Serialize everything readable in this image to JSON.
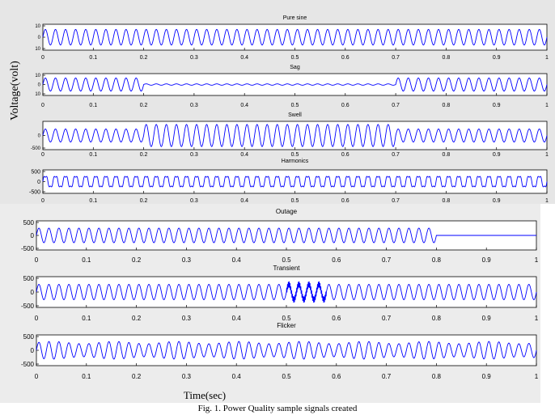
{
  "figure": {
    "ylabel": "Voltage(volt)",
    "xlabel": "Time(sec)",
    "caption": "Fig. 1. Power Quality sample signals created"
  },
  "colors": {
    "signal": "#0000ff",
    "axes": "#000000"
  },
  "chart_data": [
    {
      "type": "line",
      "title": "Pure sine",
      "xlim": [
        0,
        1
      ],
      "ylim": [
        -10,
        10
      ],
      "xticks": [
        0,
        0.1,
        0.2,
        0.3,
        0.4,
        0.5,
        0.6,
        0.7,
        0.8,
        0.9,
        1
      ],
      "ytick_labels": [
        "10",
        "0",
        "10"
      ],
      "frequency_hz": 50,
      "amplitude": 6,
      "segments": []
    },
    {
      "type": "line",
      "title": "Sag",
      "xlim": [
        0,
        1
      ],
      "ylim": [
        -10,
        10
      ],
      "xticks": [
        0,
        0.1,
        0.2,
        0.3,
        0.4,
        0.5,
        0.6,
        0.7,
        0.8,
        0.9,
        1
      ],
      "ytick_labels": [
        "10",
        "0",
        "10"
      ],
      "frequency_hz": 50,
      "amplitude": 6,
      "segments": [
        {
          "kind": "scale",
          "from": 0.2,
          "to": 0.7,
          "factor": 0.1
        }
      ]
    },
    {
      "type": "line",
      "title": "Swell",
      "xlim": [
        0,
        1
      ],
      "ylim": [
        -500,
        500
      ],
      "xticks": [
        0,
        0.1,
        0.2,
        0.3,
        0.4,
        0.5,
        0.6,
        0.7,
        0.8,
        0.9,
        1
      ],
      "ytick_labels": [
        "0",
        "-500"
      ],
      "frequency_hz": 50,
      "amplitude": 230,
      "segments": [
        {
          "kind": "scale",
          "from": 0.2,
          "to": 0.7,
          "factor": 1.7
        }
      ]
    },
    {
      "type": "line",
      "title": "Harmonics",
      "xlim": [
        0,
        1
      ],
      "ylim": [
        -500,
        500
      ],
      "xticks": [
        0,
        0.1,
        0.2,
        0.3,
        0.4,
        0.5,
        0.6,
        0.7,
        0.8,
        0.9,
        1
      ],
      "ytick_labels": [
        "500",
        "0",
        "-500"
      ],
      "frequency_hz": 50,
      "amplitude": 250,
      "segments": [
        {
          "kind": "harmonic",
          "from": 0,
          "to": 1,
          "order": 3,
          "factor": 0.25
        }
      ]
    },
    {
      "type": "line",
      "title": "Outage",
      "xlim": [
        0,
        1
      ],
      "ylim": [
        -500,
        500
      ],
      "xticks": [
        0,
        0.1,
        0.2,
        0.3,
        0.4,
        0.5,
        0.6,
        0.7,
        0.8,
        0.9,
        1
      ],
      "ytick_labels": [
        "500",
        "0",
        "-500"
      ],
      "frequency_hz": 50,
      "amplitude": 250,
      "segments": [
        {
          "kind": "scale",
          "from": 0.8,
          "to": 1.0,
          "factor": 0.0
        }
      ]
    },
    {
      "type": "line",
      "title": "Transient",
      "xlim": [
        0,
        1
      ],
      "ylim": [
        -500,
        500
      ],
      "xticks": [
        0,
        0.1,
        0.2,
        0.3,
        0.4,
        0.5,
        0.6,
        0.7,
        0.8,
        0.9,
        1
      ],
      "ytick_labels": [
        "500",
        "0",
        "-500"
      ],
      "frequency_hz": 50,
      "amplitude": 250,
      "segments": [
        {
          "kind": "oscillatory",
          "from": 0.5,
          "to": 0.58,
          "frequency_hz": 600,
          "factor": 0.45
        }
      ]
    },
    {
      "type": "line",
      "title": "Flicker",
      "xlim": [
        0,
        1
      ],
      "ylim": [
        -500,
        500
      ],
      "xticks": [
        0,
        0.1,
        0.2,
        0.3,
        0.4,
        0.5,
        0.6,
        0.7,
        0.8,
        0.9,
        1
      ],
      "ytick_labels": [
        "500",
        "0",
        "-500"
      ],
      "frequency_hz": 50,
      "amplitude": 250,
      "segments": [
        {
          "kind": "modulate",
          "from": 0,
          "to": 1,
          "frequency_hz": 8,
          "factor": 0.15
        }
      ]
    }
  ]
}
